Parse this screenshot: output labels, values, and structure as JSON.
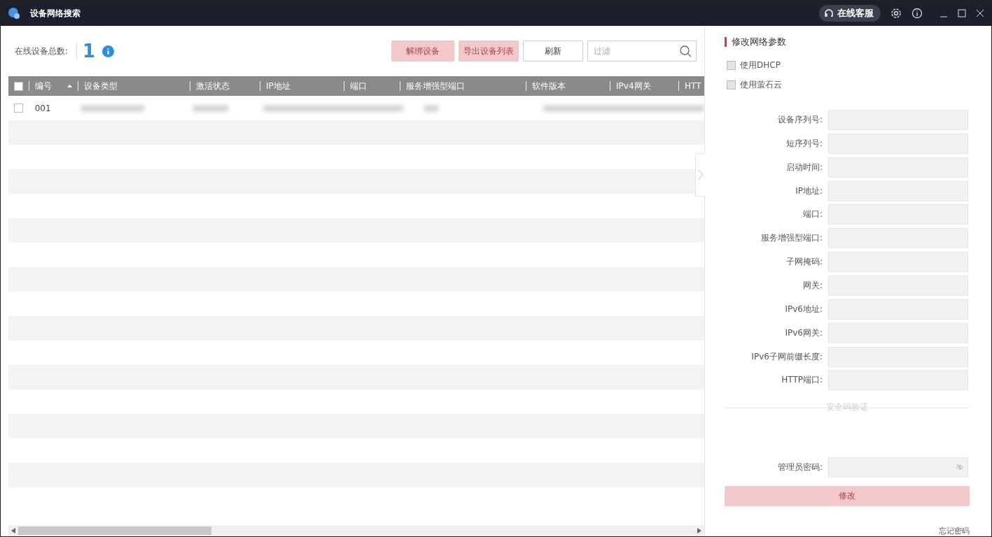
{
  "window": {
    "title": "设备网络搜索",
    "support_button": "在线客服"
  },
  "summary": {
    "label": "在线设备总数:",
    "count": "1"
  },
  "toolbar": {
    "buttons": [
      {
        "label": "解绑设备",
        "disabled": true
      },
      {
        "label": "导出设备列表",
        "disabled": true
      },
      {
        "label": "刷新",
        "disabled": false
      }
    ],
    "filter": {
      "placeholder": "过滤"
    }
  },
  "table": {
    "header_checked": false,
    "columns": [
      {
        "label": "编号",
        "sorted": true
      },
      {
        "label": "设备类型",
        "sorted": false
      },
      {
        "label": "激活状态",
        "sorted": false
      },
      {
        "label": "IP地址",
        "sorted": false
      },
      {
        "label": "端口",
        "sorted": false
      },
      {
        "label": "服务增强型端口",
        "sorted": false
      },
      {
        "label": "软件版本",
        "sorted": false
      },
      {
        "label": "IPv4网关",
        "sorted": false
      },
      {
        "label": "HTT",
        "sorted": false
      }
    ],
    "rows": [
      {
        "checked": false,
        "number": "001"
      }
    ]
  },
  "side_panel": {
    "title": "修改网络参数",
    "options": [
      {
        "label": "使用DHCP",
        "checked": false
      },
      {
        "label": "使用萤石云",
        "checked": false
      }
    ],
    "fields": [
      {
        "label": "设备序列号:"
      },
      {
        "label": "短序列号:"
      },
      {
        "label": "启动时间:"
      },
      {
        "label": "IP地址:"
      },
      {
        "label": "端口:"
      },
      {
        "label": "服务增强型端口:"
      },
      {
        "label": "子网掩码:"
      },
      {
        "label": "网关:"
      },
      {
        "label": "IPv6地址:"
      },
      {
        "label": "IPv6网关:"
      },
      {
        "label": "IPv6子网前缀长度:"
      },
      {
        "label": "HTTP端口:"
      }
    ],
    "section": "安全码验证",
    "password_label": "管理员密码:",
    "submit": {
      "label": "修改",
      "disabled": true
    },
    "forgot_link": "忘记密码"
  }
}
